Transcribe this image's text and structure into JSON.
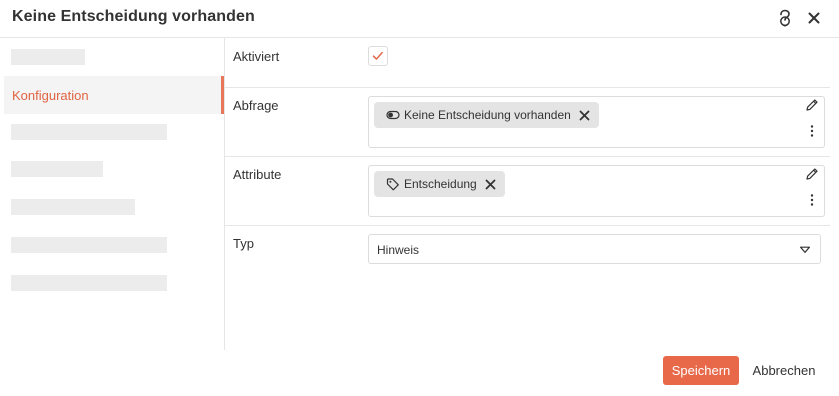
{
  "dialog": {
    "title": "Keine Entscheidung vorhanden",
    "help_icon": "help-icon",
    "close_icon": "close-icon"
  },
  "sidebar": {
    "active_item": {
      "label": "Konfiguration"
    }
  },
  "fields": {
    "aktiviert": {
      "label": "Aktiviert",
      "checked": true
    },
    "abfrage": {
      "label": "Abfrage",
      "chips": [
        {
          "icon": "toggle-icon",
          "label": "Keine Entscheidung vorhanden"
        }
      ]
    },
    "attribute": {
      "label": "Attribute",
      "chips": [
        {
          "icon": "tag-icon",
          "label": "Entscheidung"
        }
      ]
    },
    "typ": {
      "label": "Typ",
      "selected": "Hinweis"
    }
  },
  "footer": {
    "save_label": "Speichern",
    "cancel_label": "Abbrechen"
  },
  "colors": {
    "accent": "#e8684a",
    "accent_text": "#e06443",
    "placeholder": "#ececec",
    "border": "#dcdcdc",
    "chip_bg": "#e4e4e4"
  }
}
